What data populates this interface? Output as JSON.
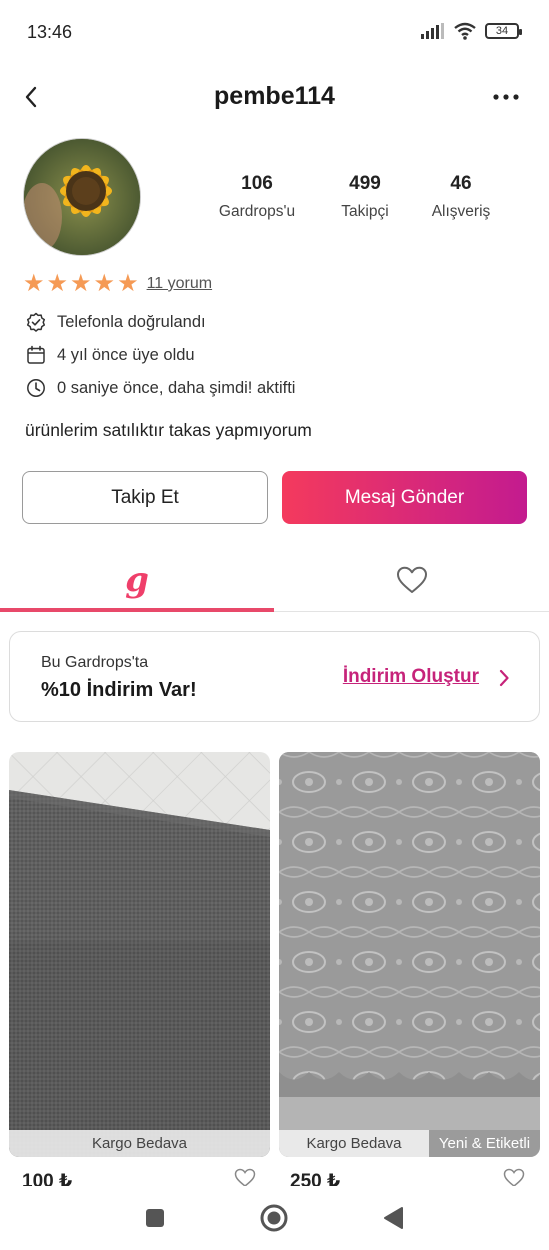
{
  "status_bar": {
    "time": "13:46",
    "battery": "34"
  },
  "header": {
    "username": "pembe114"
  },
  "profile": {
    "stats": [
      {
        "value": "106",
        "label": "Gardrops'u"
      },
      {
        "value": "499",
        "label": "Takipçi"
      },
      {
        "value": "46",
        "label": "Alışveriş"
      }
    ],
    "rating_stars": 5,
    "reviews_link": "11 yorum",
    "info": [
      {
        "icon": "verified-badge-icon",
        "text": "Telefonla doğrulandı"
      },
      {
        "icon": "calendar-icon",
        "text": "4 yıl önce üye oldu"
      },
      {
        "icon": "clock-icon",
        "text": "0 saniye önce, daha şimdi! aktifti"
      }
    ],
    "bio": "ürünlerim satılıktır takas yapmıyorum"
  },
  "actions": {
    "follow_label": "Takip Et",
    "message_label": "Mesaj Gönder"
  },
  "tabs": {
    "closet_glyph": "g",
    "active": "closet"
  },
  "promo": {
    "subtitle": "Bu Gardrops'ta",
    "title": "%10 İndirim Var!",
    "link_label": "İndirim Oluştur"
  },
  "products": [
    {
      "caption": "Kargo Bedava",
      "tag": "",
      "price": "100 ₺"
    },
    {
      "caption": "Kargo Bedava",
      "tag": "Yeni & Etiketli",
      "price": "250 ₺"
    }
  ],
  "colors": {
    "accent": "#e8496a",
    "gradient_start": "#f43a5d",
    "gradient_end": "#c31b8f",
    "star": "#f59a55",
    "promo_link": "#c6237a"
  }
}
